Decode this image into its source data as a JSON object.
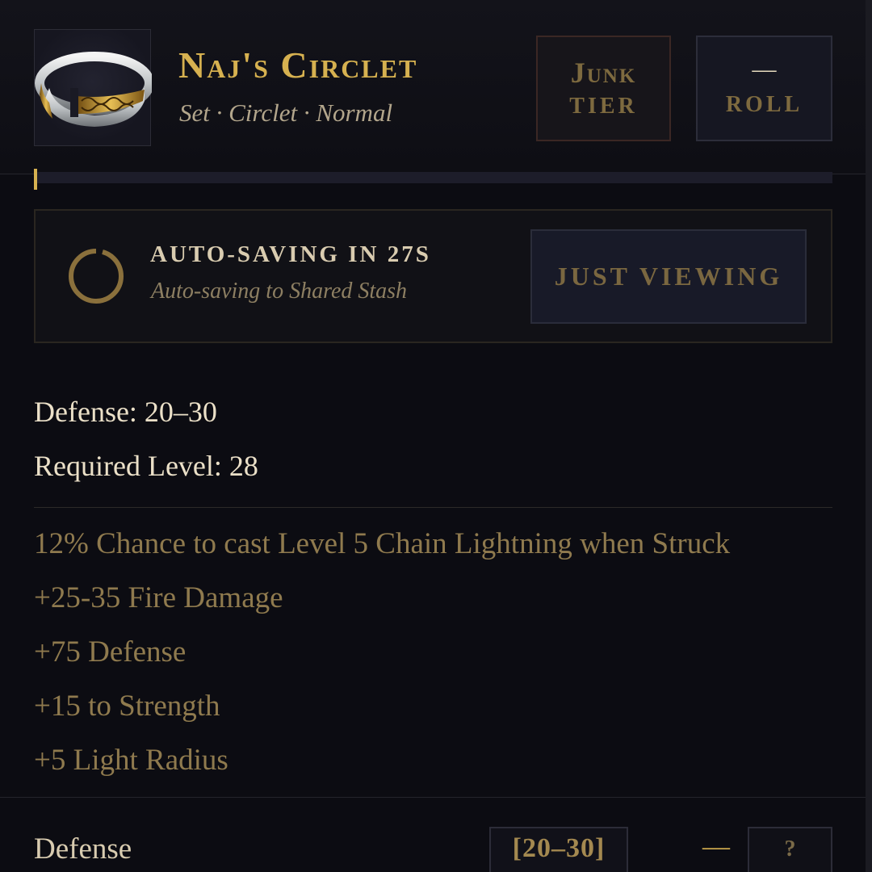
{
  "item": {
    "name": "Naj's Circlet",
    "meta": "Set · Circlet · Normal",
    "icon": "silver-gold-circlet-icon"
  },
  "header_buttons": {
    "tier": {
      "line1": "Junk",
      "line2": "Tier"
    },
    "roll": {
      "line1": "—",
      "line2": "Roll"
    }
  },
  "progress": {
    "fraction": 0.004
  },
  "autosave": {
    "title": "Auto-saving in 27s",
    "subtitle": "Auto-saving to Shared Stash",
    "button_label": "Just Viewing"
  },
  "base_stats": {
    "defense": "Defense: 20–30",
    "required_level": "Required Level: 28"
  },
  "affixes": [
    "12% Chance to cast Level 5 Chain Lightning when Struck",
    "+25-35 Fire Damage",
    "+75 Defense",
    "+15 to Strength",
    "+5 Light Radius"
  ],
  "roll_row": {
    "label": "Defense",
    "range": "[20–30]",
    "value": "—",
    "help": "?"
  },
  "colors": {
    "gold": "#d6b150",
    "affix": "#8f7a4e",
    "background": "#0c0c12"
  }
}
